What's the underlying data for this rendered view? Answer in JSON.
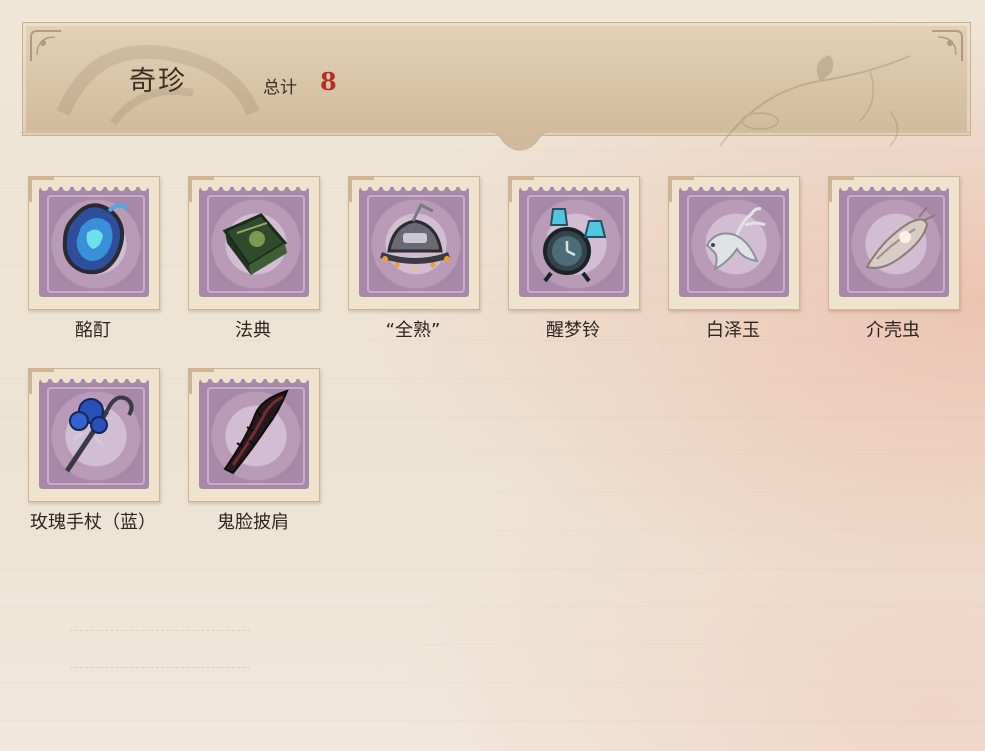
{
  "header": {
    "title": "奇珍",
    "total_label": "总计",
    "total_value": "8"
  },
  "colors": {
    "header_bg": "#d9c4a7",
    "stamp_purple": "#a788a8",
    "total_value": "#b0302a",
    "text": "#2e2520"
  },
  "items": [
    {
      "label": "酩酊",
      "icon": "blue-crystal-heart-icon"
    },
    {
      "label": "法典",
      "icon": "green-codex-book-icon"
    },
    {
      "label": "“全熟”",
      "icon": "helmet-with-sparks-icon"
    },
    {
      "label": "醒梦铃",
      "icon": "alarm-clock-bells-icon"
    },
    {
      "label": "白泽玉",
      "icon": "white-deer-jade-icon"
    },
    {
      "label": "介壳虫",
      "icon": "shell-bug-icon"
    },
    {
      "label": "玫瑰手杖（蓝）",
      "icon": "blue-rose-cane-icon"
    },
    {
      "label": "鬼脸披肩",
      "icon": "thorn-shawl-icon"
    }
  ]
}
